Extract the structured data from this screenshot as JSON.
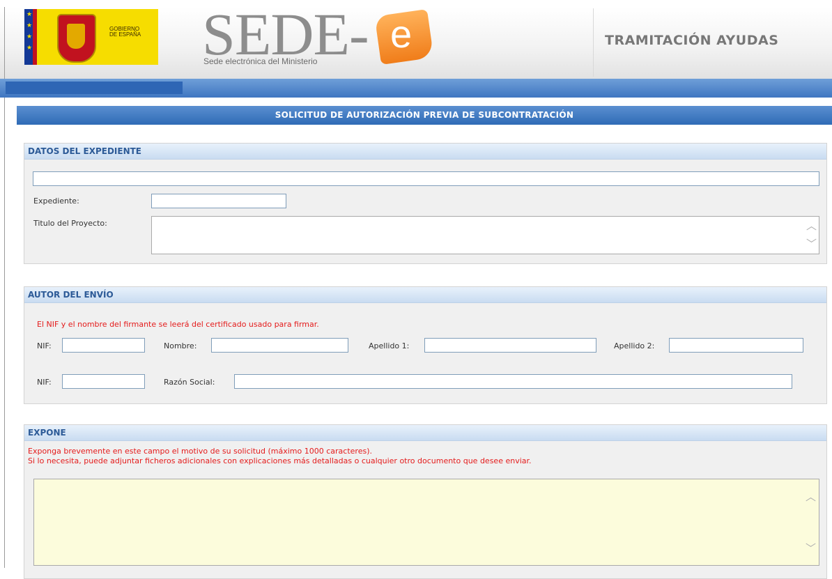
{
  "header": {
    "gov_logo_text_line1": "GOBIERNO",
    "gov_logo_text_line2": "DE ESPAÑA",
    "sede_title": "SEDE-",
    "sede_e_letter": "e",
    "sede_subtitle": "Sede electrónica del Ministerio",
    "app_title": "TRAMITACIÓN AYUDAS"
  },
  "form_title": "SOLICITUD DE AUTORIZACIÓN PREVIA DE SUBCONTRATACIÓN",
  "datos_expediente": {
    "heading": "DATOS DEL EXPEDIENTE",
    "expediente_label": "Expediente:",
    "expediente_value": "",
    "titulo_label": "Titulo del Proyecto:",
    "titulo_value": ""
  },
  "autor_envio": {
    "heading": "AUTOR DEL ENVÍO",
    "notice": "El NIF y el nombre del firmante se leerá del certificado usado para firmar.",
    "nif_label": "NIF:",
    "nombre_label": "Nombre:",
    "apellido1_label": "Apellido 1:",
    "apellido2_label": "Apellido 2:",
    "nif2_label": "NIF:",
    "razon_social_label": "Razón Social:"
  },
  "expone": {
    "heading": "EXPONE",
    "notice_line1": "Exponga brevemente en este campo el motivo de su solicitud (máximo 1000 caracteres).",
    "notice_line2": "Si lo necesita, puede adjuntar ficheros adicionales con explicaciones más detalladas o cualquier otro documento que desee enviar.",
    "text_value": ""
  },
  "colors": {
    "accent_blue": "#2f6bb6",
    "section_head_text": "#2c5a97",
    "notice_red": "#e41b1b",
    "textarea_yellow": "#fcfcdc"
  }
}
